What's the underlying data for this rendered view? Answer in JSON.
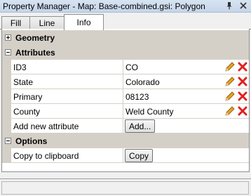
{
  "window": {
    "title": "Property Manager - Map: Base-combined.gsi: Polygon",
    "pin_icon": "pin-icon",
    "close_icon": "close-icon"
  },
  "tabs": [
    {
      "label": "Fill",
      "active": false
    },
    {
      "label": "Line",
      "active": false
    },
    {
      "label": "Info",
      "active": true
    }
  ],
  "sections": {
    "geometry": {
      "label": "Geometry",
      "expanded": false
    },
    "attributes": {
      "label": "Attributes",
      "expanded": true
    },
    "options": {
      "label": "Options",
      "expanded": true
    }
  },
  "attributes": [
    {
      "name": "ID3",
      "value": "CO"
    },
    {
      "name": "State",
      "value": "Colorado"
    },
    {
      "name": "Primary",
      "value": "08123"
    },
    {
      "name": "County",
      "value": "Weld County"
    }
  ],
  "add_attribute": {
    "label": "Add new attribute",
    "button": "Add..."
  },
  "options": {
    "copy_label": "Copy to clipboard",
    "copy_button": "Copy"
  },
  "colors": {
    "section_bg": "#d4d0c8",
    "titlebar": "#c6d6ea",
    "delete_red": "#e02020",
    "pencil": "#e8a020"
  }
}
